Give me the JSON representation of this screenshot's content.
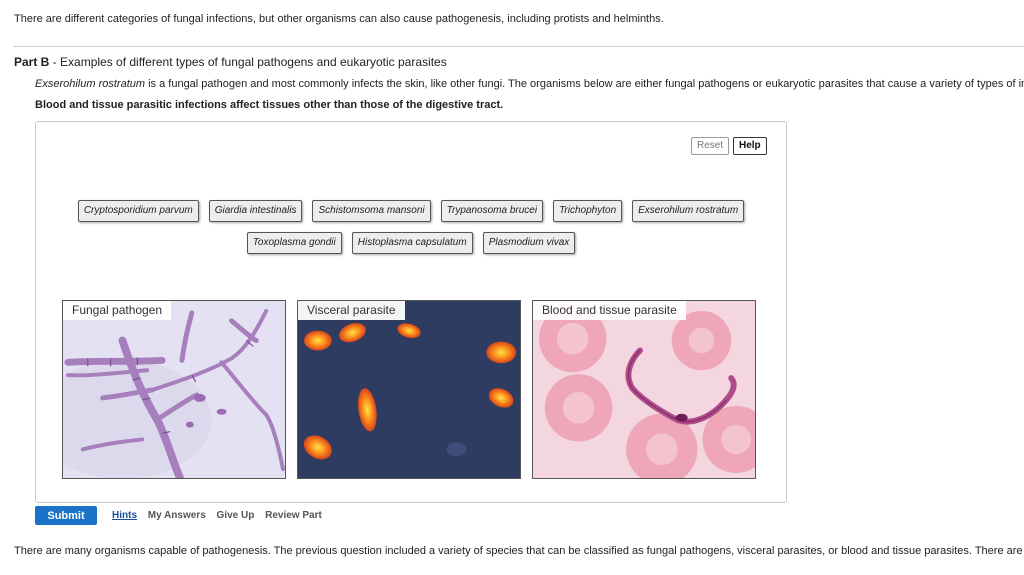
{
  "intro_text": "There are different categories of fungal infections, but other organisms can also cause pathogenesis, including protists and helminths.",
  "part": {
    "label": "Part B",
    "separator": " - ",
    "title": "Examples of different types of fungal pathogens and eukaryotic parasites",
    "description_species": "Exserohilum rostratum",
    "description_rest": " is a fungal pathogen and most commonly infects the skin, like other fungi. The organisms below are either fungal pathogens or eukaryotic parasites that cause a variety of types of inf",
    "note": "Blood and tissue parasitic infections affect tissues other than those of the digestive tract."
  },
  "controls": {
    "reset": "Reset",
    "help": "Help"
  },
  "chips_row1": [
    "Cryptosporidium parvum",
    "Giardia intestinalis",
    "Schistomsoma mansoni",
    "Trypanosoma brucei",
    "Trichophyton",
    "Exserohilum rostratum"
  ],
  "chips_row2": [
    "Toxoplasma gondii",
    "Histoplasma capsulatum",
    "Plasmodium vivax"
  ],
  "targets": [
    {
      "label": "Fungal pathogen"
    },
    {
      "label": "Visceral parasite"
    },
    {
      "label": "Blood and tissue parasite"
    }
  ],
  "actions": {
    "submit": "Submit",
    "hints": "Hints",
    "my_answers": "My Answers",
    "give_up": "Give Up",
    "review_part": "Review Part"
  },
  "bottom_text": "There are many organisms capable of pathogenesis. The previous question included a variety of species that can be classified as fungal pathogens, visceral parasites, or blood and tissue parasites. There are a",
  "colors": {
    "submit_blue": "#1a73c8",
    "hints_link": "#1a4f9a"
  }
}
